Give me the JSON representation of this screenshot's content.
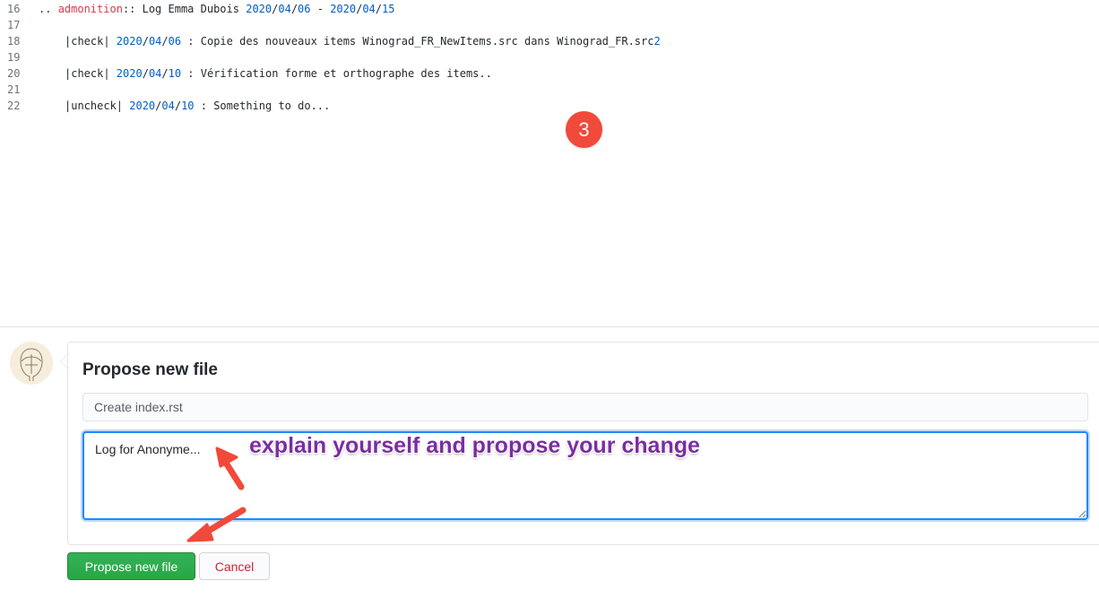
{
  "code_lines": [
    {
      "num": "16",
      "parts": [
        {
          "t": ".. ",
          "c": ""
        },
        {
          "t": "admonition",
          "c": "red"
        },
        {
          "t": ":: Log Emma Dubois ",
          "c": ""
        },
        {
          "t": "2020",
          "c": "blue"
        },
        {
          "t": "/",
          "c": ""
        },
        {
          "t": "04",
          "c": "blue"
        },
        {
          "t": "/",
          "c": ""
        },
        {
          "t": "06",
          "c": "blue"
        },
        {
          "t": " - ",
          "c": ""
        },
        {
          "t": "2020",
          "c": "blue"
        },
        {
          "t": "/",
          "c": ""
        },
        {
          "t": "04",
          "c": "blue"
        },
        {
          "t": "/",
          "c": ""
        },
        {
          "t": "15",
          "c": "blue"
        }
      ]
    },
    {
      "num": "17",
      "parts": []
    },
    {
      "num": "18",
      "indent": true,
      "parts": [
        {
          "t": "|check| ",
          "c": ""
        },
        {
          "t": "2020",
          "c": "blue"
        },
        {
          "t": "/",
          "c": ""
        },
        {
          "t": "04",
          "c": "blue"
        },
        {
          "t": "/",
          "c": ""
        },
        {
          "t": "06",
          "c": "blue"
        },
        {
          "t": " : Copie des nouveaux items Winograd_FR_NewItems.src dans Winograd_FR.src",
          "c": ""
        },
        {
          "t": "2",
          "c": "blue"
        }
      ]
    },
    {
      "num": "19",
      "parts": []
    },
    {
      "num": "20",
      "indent": true,
      "parts": [
        {
          "t": "|check| ",
          "c": ""
        },
        {
          "t": "2020",
          "c": "blue"
        },
        {
          "t": "/",
          "c": ""
        },
        {
          "t": "04",
          "c": "blue"
        },
        {
          "t": "/",
          "c": ""
        },
        {
          "t": "10",
          "c": "blue"
        },
        {
          "t": " : Vérification forme et orthographe des items..",
          "c": ""
        }
      ]
    },
    {
      "num": "21",
      "parts": []
    },
    {
      "num": "22",
      "indent": true,
      "parts": [
        {
          "t": "|uncheck| ",
          "c": ""
        },
        {
          "t": "2020",
          "c": "blue"
        },
        {
          "t": "/",
          "c": ""
        },
        {
          "t": "04",
          "c": "blue"
        },
        {
          "t": "/",
          "c": ""
        },
        {
          "t": "10",
          "c": "blue"
        },
        {
          "t": " : Something to do...",
          "c": ""
        }
      ]
    }
  ],
  "step_badge": "3",
  "form": {
    "title": "Propose new file",
    "summary_placeholder": "Create index.rst",
    "description_value": "Log for Anonyme...",
    "submit_label": "Propose new file",
    "cancel_label": "Cancel"
  },
  "annotation": "explain yourself and propose your change",
  "colors": {
    "keyword": "#d73a49",
    "number": "#005cc5",
    "primary": "#2ea44f",
    "cancel_text": "#cb2431",
    "badge": "#f1493a",
    "annotation": "#7b2ea0",
    "arrow": "#f1493a",
    "focus": "#2188ff"
  }
}
